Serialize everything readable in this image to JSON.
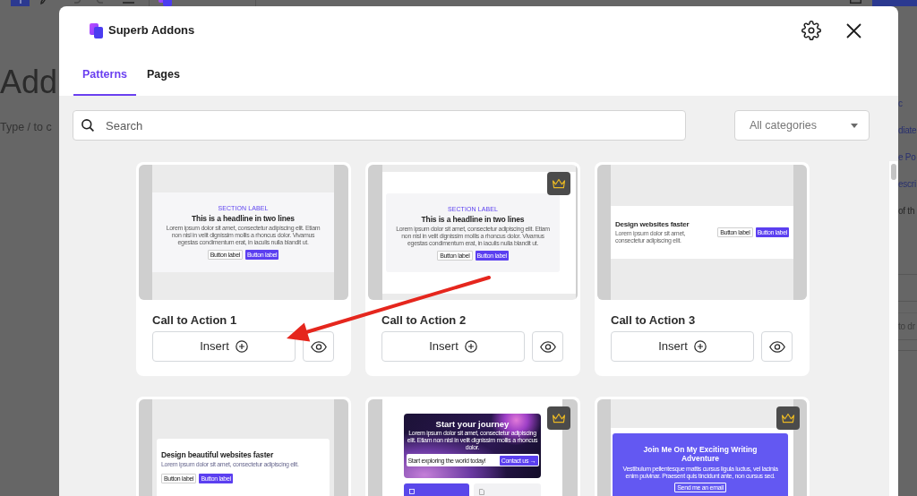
{
  "editor": {
    "title": "Add",
    "hint": "Type / to c",
    "sidebar": [
      {
        "text": "c",
        "kind": "link"
      },
      {
        "text": "diate",
        "kind": "link"
      },
      {
        "text": "e Po",
        "kind": "link"
      },
      {
        "text": "escri",
        "kind": "link"
      },
      {
        "text": "of th",
        "kind": "text"
      },
      {
        "text": "to dr",
        "kind": "hint"
      }
    ]
  },
  "modal": {
    "brand": "Superb Addons",
    "tabs": [
      {
        "label": "Patterns",
        "selected": true
      },
      {
        "label": "Pages",
        "selected": false
      }
    ],
    "search": {
      "placeholder": "Search"
    },
    "category_select": {
      "value": "All categories"
    },
    "patterns": [
      {
        "title": "Call to Action 1",
        "insert_label": "Insert",
        "premium": false,
        "preview": {
          "kind": "centered",
          "label": "SECTION LABEL",
          "headline": "This is a headline in two lines",
          "body": "Lorem ipsum dolor sit amet, consectetur adipiscing elit. Etiam non nisl in velit dignissim mollis a rhoncus dolor. Vivamus egestas condimentum erat, in iaculis nulla blandit ut.",
          "buttons": [
            {
              "label": "Button label",
              "primary": false
            },
            {
              "label": "Button label",
              "primary": true
            }
          ]
        }
      },
      {
        "title": "Call to Action 2",
        "insert_label": "Insert",
        "premium": true,
        "preview": {
          "kind": "boxed",
          "label": "SECTION LABEL",
          "headline": "This is a headline in two lines",
          "body": "Lorem ipsum dolor sit amet, consectetur adipiscing elit. Etiam non nisl in velit dignissim mollis a rhoncus dolor. Vivamus egestas condimentum erat, in iaculis nulla blandit ut.",
          "buttons": [
            {
              "label": "Button label",
              "primary": false
            },
            {
              "label": "Button label",
              "primary": true
            }
          ]
        }
      },
      {
        "title": "Call to Action 3",
        "insert_label": "Insert",
        "premium": false,
        "preview": {
          "kind": "split",
          "headline": "Design websites faster",
          "body": "Lorem ipsum dolor sit amet, consectetur adipiscing elit.",
          "buttons": [
            {
              "label": "Button label",
              "primary": false
            },
            {
              "label": "Button label",
              "primary": true
            }
          ]
        }
      },
      {
        "premium": false,
        "preview": {
          "kind": "card",
          "headline": "Design beautiful websites faster",
          "body": "Lorem ipsum dolor sit amet, consectetur adipiscing elit.",
          "buttons": [
            {
              "label": "Button label",
              "primary": false
            },
            {
              "label": "Button label",
              "primary": true
            }
          ]
        }
      },
      {
        "premium": true,
        "preview": {
          "kind": "hero",
          "headline": "Start your journey",
          "body": "Lorem ipsum dolor sit amet, consectetur adipiscing elit. Etiam non nisl in velit dignissim mollis a rhoncus dolor.",
          "field": "Start exploring the world today!",
          "buttons": [
            {
              "label": "Contact us →",
              "primary": true
            }
          ]
        }
      },
      {
        "premium": true,
        "preview": {
          "kind": "banner",
          "headline": "Join Me On My Exciting Writing Adventure",
          "body": "Vestibulum pellentesque mattis cursus ligula luctus, vel lacinia enim pulvinar. Praesent quis tincidunt ante, non cursus sed.",
          "buttons": [
            {
              "label": "Send me an email",
              "primary": false
            }
          ]
        }
      }
    ]
  }
}
